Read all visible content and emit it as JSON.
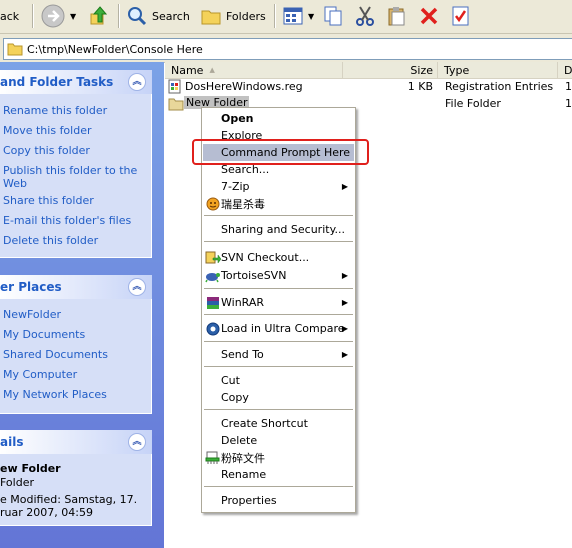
{
  "toolbar": {
    "back_label": "ack",
    "search_label": "Search",
    "folders_label": "Folders"
  },
  "address": {
    "path": "C:\\tmp\\NewFolder\\Console Here"
  },
  "tasks_panel": {
    "title": "and Folder Tasks",
    "items": [
      "Rename this folder",
      "Move this folder",
      "Copy this folder",
      "Publish this folder to the",
      "Web",
      "Share this folder",
      "E-mail this folder's files",
      "Delete this folder"
    ]
  },
  "places_panel": {
    "title": "er Places",
    "items": [
      "NewFolder",
      "My Documents",
      "Shared Documents",
      "My Computer",
      "My Network Places"
    ]
  },
  "details_panel": {
    "title": "ails",
    "name": "ew Folder",
    "type": "Folder",
    "modified_line1": "e Modified: Samstag, 17.",
    "modified_line2": "ruar 2007, 04:59"
  },
  "columns": {
    "name": "Name",
    "size": "Size",
    "type": "Type",
    "date": "D"
  },
  "files": [
    {
      "name": "DosHereWindows.reg",
      "size": "1 KB",
      "type": "Registration Entries",
      "date": "1"
    },
    {
      "name": "New Folder",
      "size": "",
      "type": "File Folder",
      "date": "1"
    }
  ],
  "context_menu": {
    "open": "Open",
    "explore": "Explore",
    "command_prompt": "Command Prompt Here",
    "search": "Search...",
    "seven_zip": "7-Zip",
    "rising": "瑞星杀毒",
    "sharing": "Sharing and Security...",
    "svn_checkout": "SVN Checkout...",
    "tortoise": "TortoiseSVN",
    "winrar": "WinRAR",
    "ultracompare": "Load in Ultra Compare",
    "send_to": "Send To",
    "cut": "Cut",
    "copy": "Copy",
    "create_shortcut": "Create Shortcut",
    "delete": "Delete",
    "shred": "粉碎文件",
    "rename": "Rename",
    "properties": "Properties"
  },
  "colors": {
    "highlight": "#e0201c",
    "link": "#215dc6",
    "panel_bg": "#d6dff7"
  }
}
